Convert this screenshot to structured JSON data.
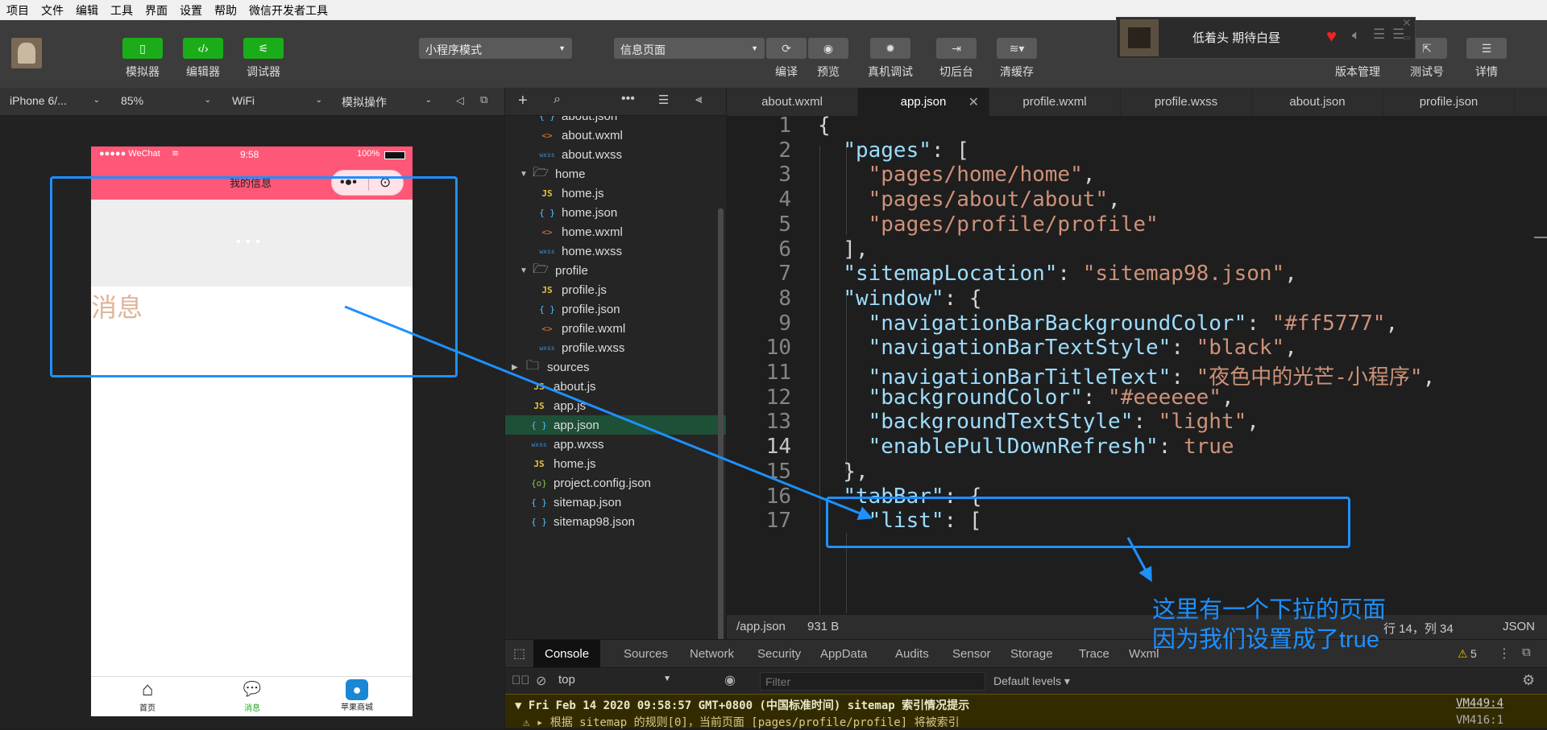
{
  "menu": [
    "项目",
    "文件",
    "编辑",
    "工具",
    "界面",
    "设置",
    "帮助",
    "微信开发者工具"
  ],
  "toolbar": {
    "simulator": "模拟器",
    "editor": "编辑器",
    "debugger": "调试器",
    "mode_select": "小程序模式",
    "page_select": "信息页面",
    "compile": "编译",
    "preview": "预览",
    "real_debug": "真机调试",
    "background": "切后台",
    "clear_cache": "清缓存",
    "version_mgmt": "版本管理",
    "test_account": "测试号",
    "details": "详情"
  },
  "music": {
    "title": "低着头 期待白昼"
  },
  "device_bar": {
    "device": "iPhone 6/...",
    "zoom": "85%",
    "network": "WiFi",
    "operation": "模拟操作"
  },
  "phone": {
    "carrier": "●●●●● WeChat",
    "time": "9:58",
    "battery": "100%",
    "nav_title": "我的信息",
    "pull_dots": "• • •",
    "content_text": "消息",
    "tabs": [
      "首页",
      "消息",
      "苹果商城"
    ]
  },
  "file_tree": [
    {
      "name": "about.json",
      "type": "json",
      "indent": 2
    },
    {
      "name": "about.wxml",
      "type": "xml",
      "indent": 2
    },
    {
      "name": "about.wxss",
      "type": "wxss",
      "indent": 2
    },
    {
      "name": "home",
      "type": "folder-open",
      "indent": 1
    },
    {
      "name": "home.js",
      "type": "js",
      "indent": 2
    },
    {
      "name": "home.json",
      "type": "json",
      "indent": 2
    },
    {
      "name": "home.wxml",
      "type": "xml",
      "indent": 2
    },
    {
      "name": "home.wxss",
      "type": "wxss",
      "indent": 2
    },
    {
      "name": "profile",
      "type": "folder-open",
      "indent": 1
    },
    {
      "name": "profile.js",
      "type": "js",
      "indent": 2
    },
    {
      "name": "profile.json",
      "type": "json",
      "indent": 2
    },
    {
      "name": "profile.wxml",
      "type": "xml",
      "indent": 2
    },
    {
      "name": "profile.wxss",
      "type": "wxss",
      "indent": 2
    },
    {
      "name": "sources",
      "type": "folder-closed",
      "indent": 0
    },
    {
      "name": "about.js",
      "type": "js",
      "indent": 1
    },
    {
      "name": "app.js",
      "type": "js",
      "indent": 1
    },
    {
      "name": "app.json",
      "type": "json",
      "indent": 1,
      "active": true
    },
    {
      "name": "app.wxss",
      "type": "wxss",
      "indent": 1
    },
    {
      "name": "home.js",
      "type": "js",
      "indent": 1
    },
    {
      "name": "project.config.json",
      "type": "cfg",
      "indent": 1
    },
    {
      "name": "sitemap.json",
      "type": "json",
      "indent": 1
    },
    {
      "name": "sitemap98.json",
      "type": "json",
      "indent": 1
    }
  ],
  "editor_tabs": [
    {
      "label": "about.wxml",
      "active": false
    },
    {
      "label": "app.json",
      "active": true
    },
    {
      "label": "profile.wxml",
      "active": false
    },
    {
      "label": "profile.wxss",
      "active": false
    },
    {
      "label": "about.json",
      "active": false
    },
    {
      "label": "profile.json",
      "active": false
    }
  ],
  "code_lines": [
    "{",
    "  \"pages\": [",
    "    \"pages/home/home\",",
    "    \"pages/about/about\",",
    "    \"pages/profile/profile\"",
    "  ],",
    "  \"sitemapLocation\": \"sitemap98.json\",",
    "  \"window\": {",
    "    \"navigationBarBackgroundColor\": \"#ff5777\",",
    "    \"navigationBarTextStyle\": \"black\",",
    "    \"navigationBarTitleText\": \"夜色中的光芒-小程序\",",
    "    \"backgroundColor\": \"#eeeeee\",",
    "    \"backgroundTextStyle\": \"light\",",
    "    \"enablePullDownRefresh\": true",
    "  },",
    "  \"tabBar\": {",
    "    \"list\": ["
  ],
  "current_line": 14,
  "editor_status": {
    "path": "/app.json",
    "size": "931 B",
    "position": "行 14，列 34",
    "lang": "JSON"
  },
  "devtools_tabs": [
    "Console",
    "Sources",
    "Network",
    "Security",
    "AppData",
    "Audits",
    "Sensor",
    "Storage",
    "Trace",
    "Wxml"
  ],
  "devtools": {
    "warnings": "5",
    "context": "top",
    "filter_placeholder": "Filter",
    "levels": "Default levels ▾"
  },
  "console": {
    "line1": "▼ Fri Feb 14 2020 09:58:57 GMT+0800 (中国标准时间) sitemap 索引情况提示",
    "line1_src": "VM449:4",
    "line2": "⚠  ▸ 根据 sitemap 的规则[0]，当前页面 [pages/profile/profile] 将被索引",
    "line2_src": "VM416:1"
  },
  "annotation": {
    "line1": "这里有一个下拉的页面",
    "line2": "因为我们设置成了true",
    "color": "#1e90ff"
  }
}
